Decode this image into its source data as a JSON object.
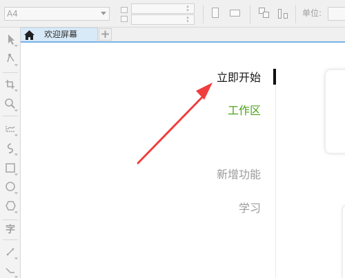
{
  "property_bar": {
    "page_size": "A4",
    "units_label": "单位:",
    "icons": {
      "dimension": "dimension-icon",
      "portrait": "portrait-page-icon",
      "landscape": "landscape-page-icon",
      "all_pages": "all-pages-icon",
      "current_page": "current-page-icon"
    }
  },
  "tabs": {
    "welcome_label": "欢迎屏幕",
    "add_tab_symbol": "+"
  },
  "toolbox": {
    "text_tool_label": "字",
    "icons": [
      "pick-tool-icon",
      "shape-tool-icon",
      "crop-tool-icon",
      "zoom-tool-icon",
      "freehand-tool-icon",
      "artistic-media-tool-icon",
      "rectangle-tool-icon",
      "ellipse-tool-icon",
      "polygon-tool-icon",
      "text-tool-icon",
      "parallel-dimension-tool-icon",
      "connector-tool-icon"
    ]
  },
  "welcome_nav": {
    "items": [
      {
        "label": "立即开始",
        "state": "active",
        "color": "#171717"
      },
      {
        "label": "工作区",
        "state": "accent",
        "color": "#4ca21a"
      },
      {
        "label": "新增功能",
        "state": "normal",
        "color": "#9b9b9b"
      },
      {
        "label": "学习",
        "state": "normal",
        "color": "#9b9b9b"
      }
    ]
  },
  "colors": {
    "tab_accent": "#78b2e6",
    "arrow": "#ef3e3e",
    "active_indicator": "#101010"
  }
}
